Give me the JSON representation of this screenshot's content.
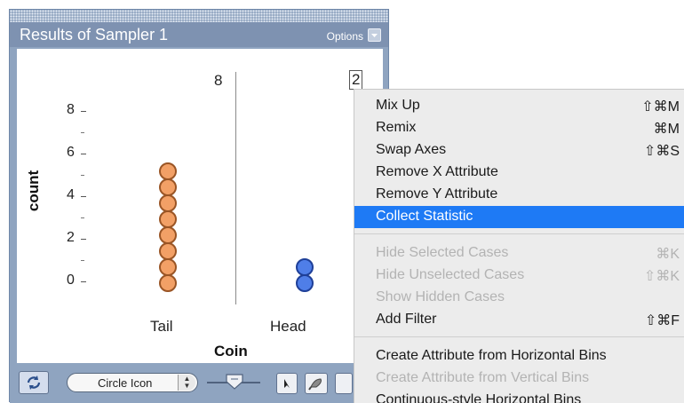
{
  "window": {
    "title": "Results of Sampler 1",
    "options_label": "Options"
  },
  "graph": {
    "y_axis_label": "count",
    "x_axis_label": "Coin",
    "y_ticks": [
      "8",
      "6",
      "4",
      "2",
      "0"
    ],
    "categories": [
      "Tail",
      "Head"
    ],
    "category_counts": {
      "Tail": 8,
      "Head": 2
    },
    "corner_values": [
      "8",
      "2"
    ],
    "colors": {
      "tail": "#f2a066",
      "head": "#4f7ee8"
    }
  },
  "toolbar": {
    "point_style_select": "Circle Icon",
    "icons": [
      "rerandomize-icon",
      "slider-icon",
      "arrow-cursor-icon",
      "brush-icon"
    ]
  },
  "menu": {
    "items": [
      {
        "label": "Mix Up",
        "shortcut": "⇧⌘M",
        "disabled": false
      },
      {
        "label": "Remix",
        "shortcut": "⌘M",
        "disabled": false
      },
      {
        "label": "Swap Axes",
        "shortcut": "⇧⌘S",
        "disabled": false
      },
      {
        "label": "Remove X Attribute",
        "shortcut": "",
        "disabled": false
      },
      {
        "label": "Remove Y Attribute",
        "shortcut": "",
        "disabled": false
      },
      {
        "label": "Collect Statistic",
        "shortcut": "",
        "disabled": false,
        "highlighted": true
      },
      {
        "label": "Hide Selected Cases",
        "shortcut": "⌘K",
        "disabled": true
      },
      {
        "label": "Hide Unselected Cases",
        "shortcut": "⇧⌘K",
        "disabled": true
      },
      {
        "label": "Show Hidden Cases",
        "shortcut": "",
        "disabled": true
      },
      {
        "label": "Add Filter",
        "shortcut": "⇧⌘F",
        "disabled": false
      },
      {
        "label": "Create Attribute from Horizontal Bins",
        "shortcut": "",
        "disabled": false
      },
      {
        "label": "Create Attribute from Vertical Bins",
        "shortcut": "",
        "disabled": true
      },
      {
        "label": "Continuous-style Horizontal Bins",
        "shortcut": "",
        "disabled": false
      }
    ]
  }
}
